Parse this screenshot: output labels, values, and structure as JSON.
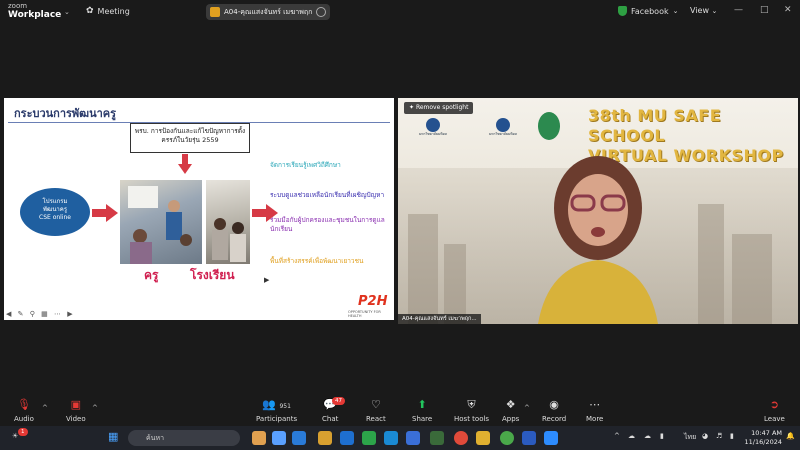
{
  "app": {
    "brand_line1": "zoom",
    "brand_line2": "Workplace",
    "meeting_label": "Meeting"
  },
  "share": {
    "title": "A04-คุณแสงจันทร์ เมฆาพฤกษ์'s scre"
  },
  "topright": {
    "facebook_label": "Facebook",
    "view_label": "View"
  },
  "slide": {
    "title": "กระบวนการพัฒนาครู",
    "top_box": "พรบ. การป้องกันและแก้ไขปัญหาการตั้งครรภ์ในวัยรุ่น 2559",
    "oval_lines": [
      "โปรแกรม",
      "พัฒนาครู",
      "CSE online"
    ],
    "label_teacher": "ครู",
    "label_school": "โรงเรียน",
    "bullets": [
      {
        "text": "จัดการเรียนรู้เพศวิถีศึกษา",
        "color": "#2aa7b8"
      },
      {
        "text": "ระบบดูแลช่วยเหลือนักเรียนที่เผชิญปัญหา",
        "color": "#3a2fb0"
      },
      {
        "text": "ร่วมมือกับผู้ปกครองและชุมชนในการดูแลนักเรียน",
        "color": "#8a2fb0"
      },
      {
        "text": "พื้นที่สร้างสรรค์เพื่อพัฒนาเยาวชน",
        "color": "#e0a020"
      }
    ],
    "logo": "P2H",
    "logo_sub": "OPPORTUNITY FOR HEALTH"
  },
  "video": {
    "spotlight_label": "Remove spotlight",
    "event_title_line1": "38th MU SAFE SCHOOL",
    "event_title_line2": "VIRTUAL WORKSHOP",
    "logo1_text": "มหาวิทยาลัยมหิดล",
    "logo2_text": "มหาวิทยาลัยมหิดล",
    "participant_name": "A04-คุณแสงจันทร์ เมฆาพฤก..."
  },
  "toolbar": {
    "audio": "Audio",
    "video": "Video",
    "participants": "Participants",
    "participants_count": "951",
    "chat": "Chat",
    "chat_badge": "47",
    "react": "React",
    "share": "Share",
    "host_tools": "Host tools",
    "apps": "Apps",
    "record": "Record",
    "more": "More",
    "leave": "Leave"
  },
  "taskbar": {
    "search_placeholder": "ค้นหา",
    "lang": "ไทย",
    "time": "10:47 AM",
    "date": "11/16/2024",
    "notif_badge": "1"
  },
  "colors": {
    "accent_green": "#2ea043",
    "leave_red": "#e53935",
    "share_green": "#22c55e"
  }
}
